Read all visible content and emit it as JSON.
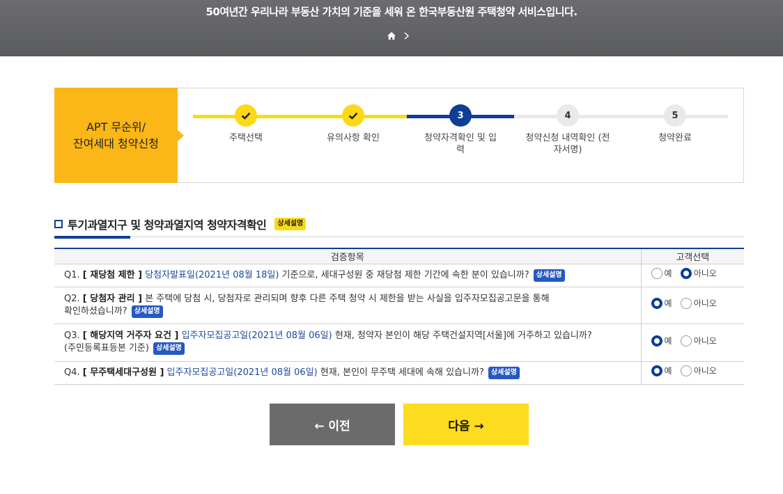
{
  "banner": {
    "text": "50여년간 우리나라 부동산 가치의 기준을 세워 온 한국부동산원 주택청약 서비스입니다.",
    "breadcrumb_icons": [
      "home-icon",
      "chevron-right-icon"
    ]
  },
  "stepper": {
    "title_line1": "APT 무순위/",
    "title_line2": "잔여세대 청약신청",
    "steps": [
      {
        "mark": "check",
        "label": "주택선택",
        "state": "done"
      },
      {
        "mark": "check",
        "label": "유의사항 확인",
        "state": "done"
      },
      {
        "mark": "3",
        "label": "청약자격확인 및 입력",
        "state": "active"
      },
      {
        "mark": "4",
        "label": "청약신청 내역확인 (전자서명)",
        "state": "todo"
      },
      {
        "mark": "5",
        "label": "청약완료",
        "state": "todo"
      }
    ],
    "colors": {
      "done": "#fcd914",
      "active": "#0d3e94",
      "todo": "#e9e9e9"
    }
  },
  "section": {
    "title": "투기과열지구 및 청약과열지역 청약자격확인",
    "detail_badge": "상세설명"
  },
  "table": {
    "headers": [
      "검증항목",
      "고객선택"
    ],
    "rows": [
      {
        "num": "Q1.",
        "bold": "[ 재당첨 제한 ]",
        "link": "당첨자발표일(2021년 08월 18일)",
        "text": "기준으로, 세대구성원 중 재당첨 제한 기간에 속한 분이 있습니까?",
        "extra": "",
        "badge": "상세설명",
        "yes": "예",
        "no": "아니오",
        "selected": "아니오"
      },
      {
        "num": "Q2.",
        "bold": "[ 당첨자 관리 ]",
        "link": "",
        "text": "본 주택에 당첨 시, 당첨자로 관리되며 향후 다른 주택 청약 시 제한을 받는 사실을 입주자모집공고문을 통해",
        "extra": "확인하셨습니까?",
        "badge": "상세설명",
        "yes": "예",
        "no": "아니오",
        "selected": "예"
      },
      {
        "num": "Q3.",
        "bold": "[ 해당지역 거주자 요건 ]",
        "link": "입주자모집공고일(2021년 08월 06일)",
        "text": "현재, 청약자 본인이 해당 주택건설지역[서울]에 거주하고 있습니까?",
        "extra": "(주민등록표등본 기준)",
        "badge": "상세설명",
        "yes": "예",
        "no": "아니오",
        "selected": "예"
      },
      {
        "num": "Q4.",
        "bold": "[ 무주택세대구성원 ]",
        "link": "입주자모집공고일(2021년 08월 06일)",
        "text": "현재, 본인이 무주택 세대에 속해 있습니까?",
        "extra": "",
        "badge": "상세설명",
        "yes": "예",
        "no": "아니오",
        "selected": "예"
      }
    ]
  },
  "buttons": {
    "prev": "← 이전",
    "next": "다음 →"
  }
}
